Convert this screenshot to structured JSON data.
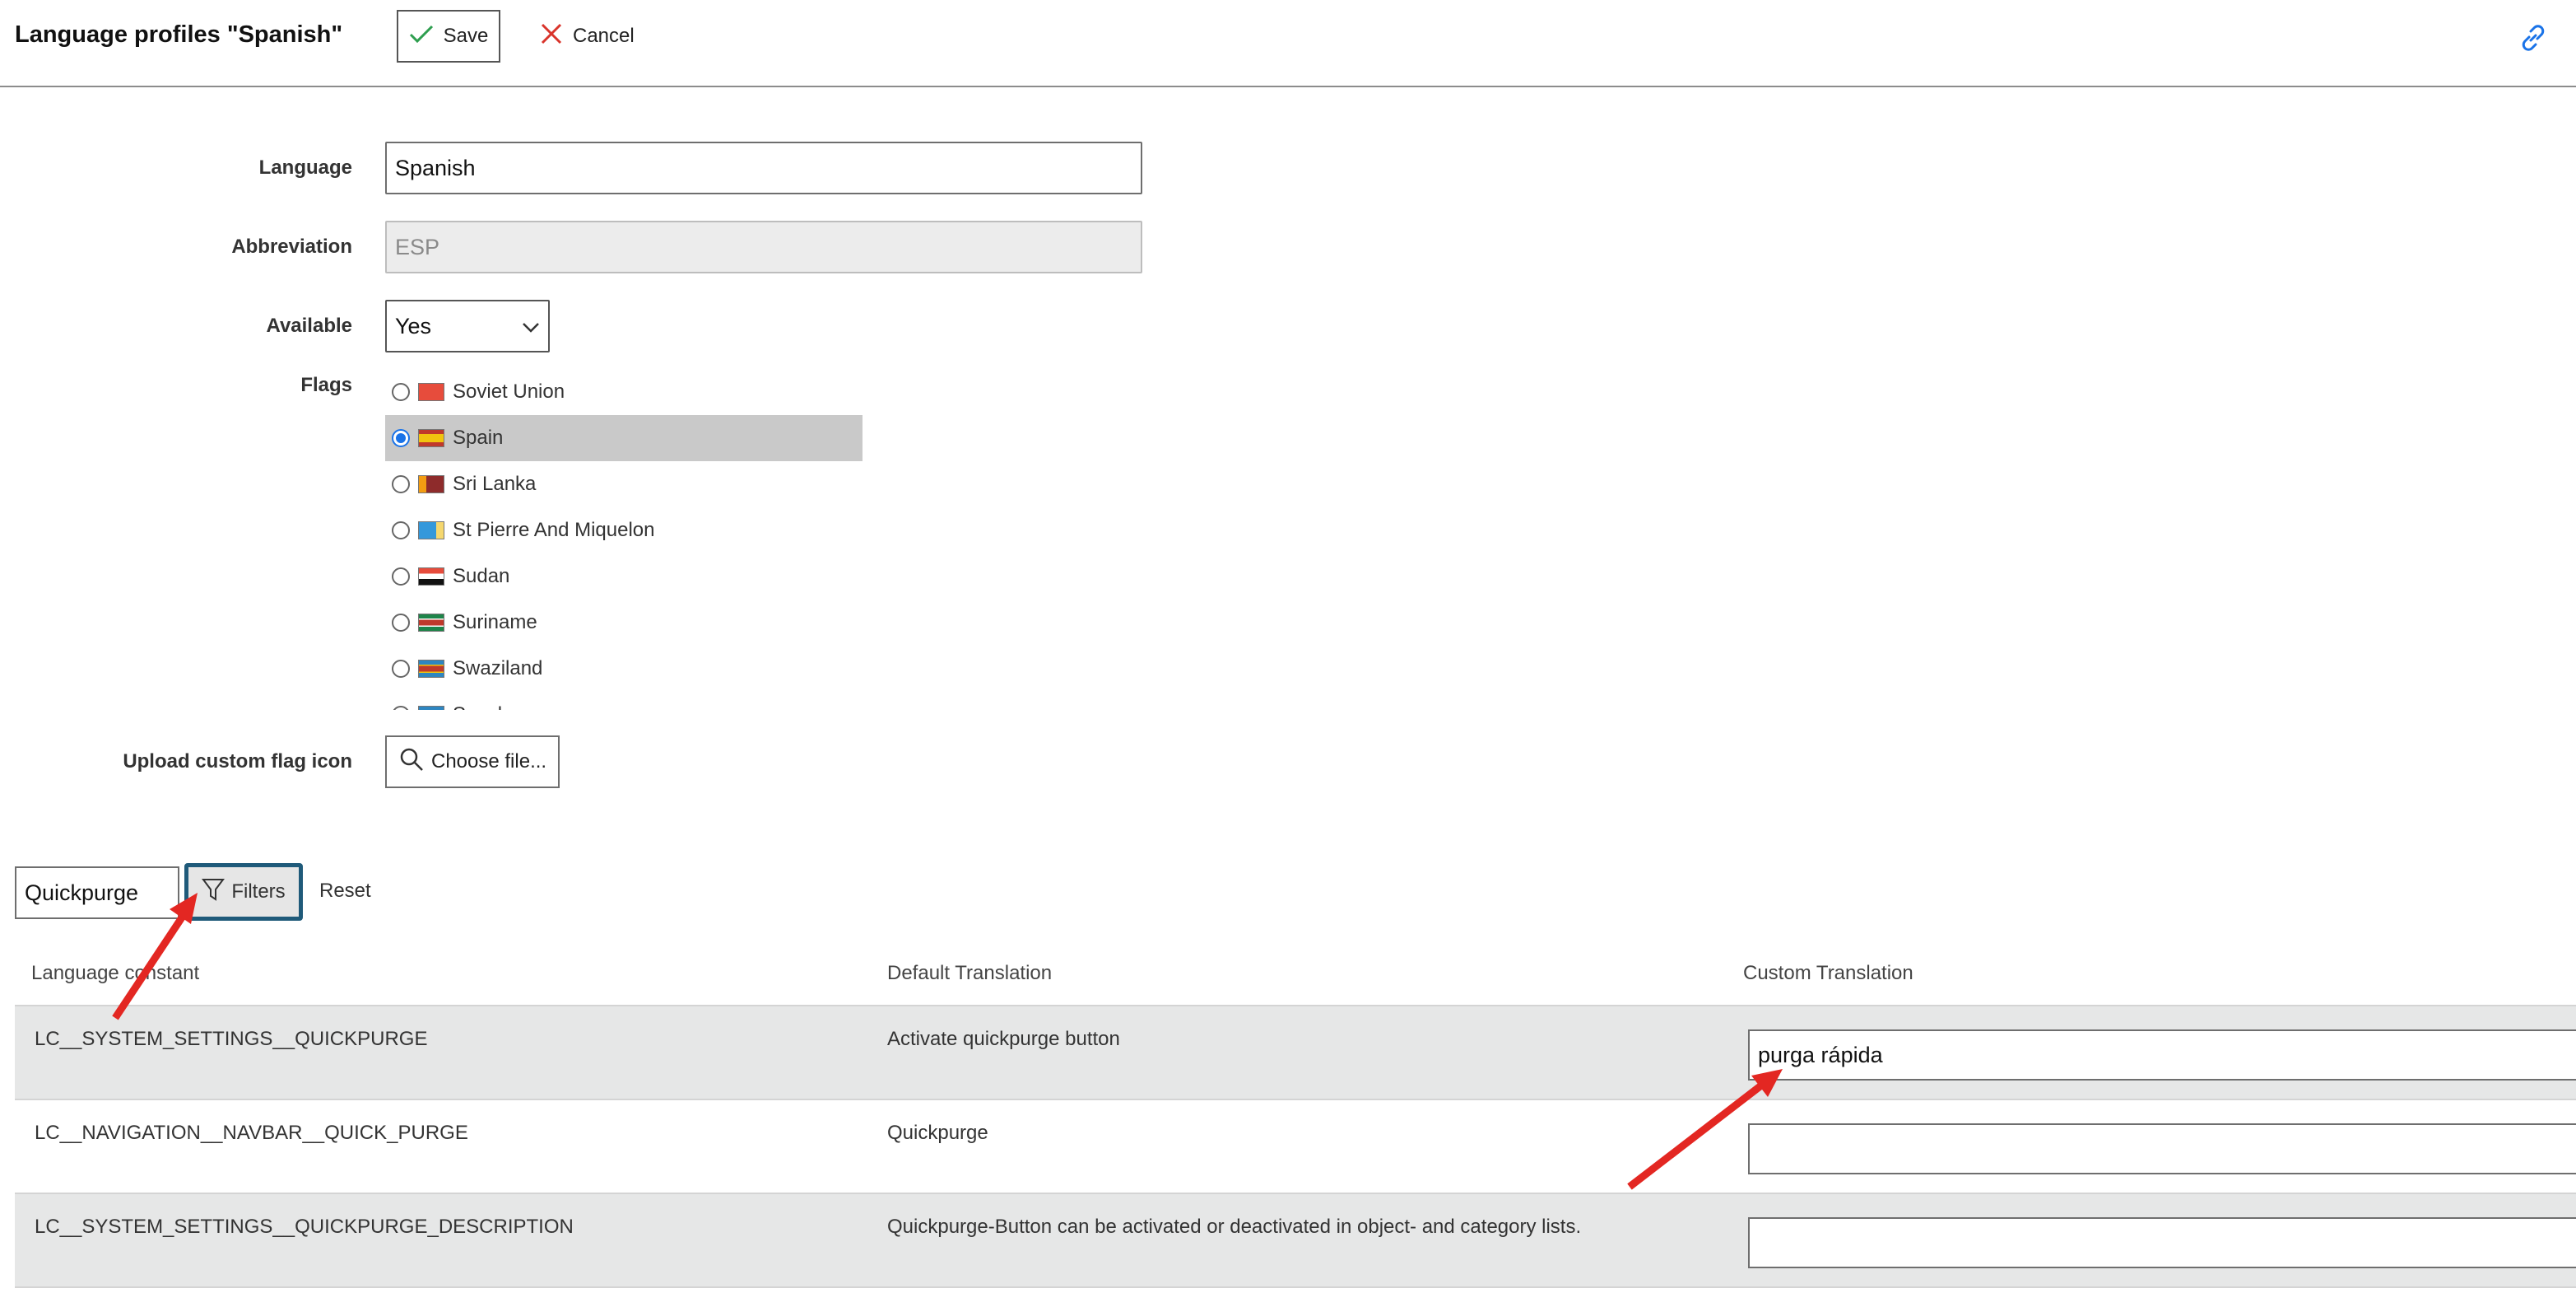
{
  "header": {
    "title": "Language profiles \"Spanish\"",
    "save_label": "Save",
    "cancel_label": "Cancel"
  },
  "form": {
    "language_label": "Language",
    "language_value": "Spanish",
    "abbreviation_label": "Abbreviation",
    "abbreviation_value": "ESP",
    "available_label": "Available",
    "available_value": "Yes",
    "flags_label": "Flags",
    "flags": [
      {
        "name": "Soviet Union",
        "selected": false,
        "colors": [
          "#e74c3c",
          "#e74c3c"
        ]
      },
      {
        "name": "Spain",
        "selected": true,
        "colors": [
          "#c0392b",
          "#f1c40f"
        ]
      },
      {
        "name": "Sri Lanka",
        "selected": false,
        "colors": [
          "#f39c12",
          "#8e2b2b"
        ]
      },
      {
        "name": "St Pierre And Miquelon",
        "selected": false,
        "colors": [
          "#3498db",
          "#f5d76e"
        ]
      },
      {
        "name": "Sudan",
        "selected": false,
        "colors": [
          "#e74c3c",
          "#1e8449"
        ]
      },
      {
        "name": "Suriname",
        "selected": false,
        "colors": [
          "#1e8449",
          "#c0392b"
        ]
      },
      {
        "name": "Swaziland",
        "selected": false,
        "colors": [
          "#2e86c1",
          "#c0392b"
        ]
      },
      {
        "name": "Sweden",
        "selected": false,
        "colors": [
          "#2e86c1",
          "#f1c40f"
        ]
      }
    ],
    "upload_label": "Upload custom flag icon",
    "choose_file_label": "Choose file..."
  },
  "filter": {
    "search_value": "Quickpurge",
    "filters_label": "Filters",
    "reset_label": "Reset"
  },
  "table": {
    "columns": [
      "Language constant",
      "Default Translation",
      "Custom Translation"
    ],
    "rows": [
      {
        "constant": "LC__SYSTEM_SETTINGS__QUICKPURGE",
        "default": "Activate quickpurge button",
        "custom": "purga rápida"
      },
      {
        "constant": "LC__NAVIGATION__NAVBAR__QUICK_PURGE",
        "default": "Quickpurge",
        "custom": ""
      },
      {
        "constant": "LC__SYSTEM_SETTINGS__QUICKPURGE_DESCRIPTION",
        "default": "Quickpurge-Button can be activated or deactivated in object- and category lists.",
        "custom": ""
      }
    ]
  },
  "icons": {
    "save": "checkmark-icon",
    "cancel": "x-icon",
    "link": "link-icon",
    "choose_file": "search-icon",
    "filters": "funnel-icon",
    "select": "chevron-down-icon"
  },
  "colors": {
    "accent": "#1f5a7a",
    "save_check": "#2e9e4f",
    "cancel_x": "#d9342b",
    "link": "#1a73e8",
    "annotation_arrow": "#e32722",
    "row_shade": "#e6e7e7",
    "selected_flag_row": "#c9c9c9"
  }
}
